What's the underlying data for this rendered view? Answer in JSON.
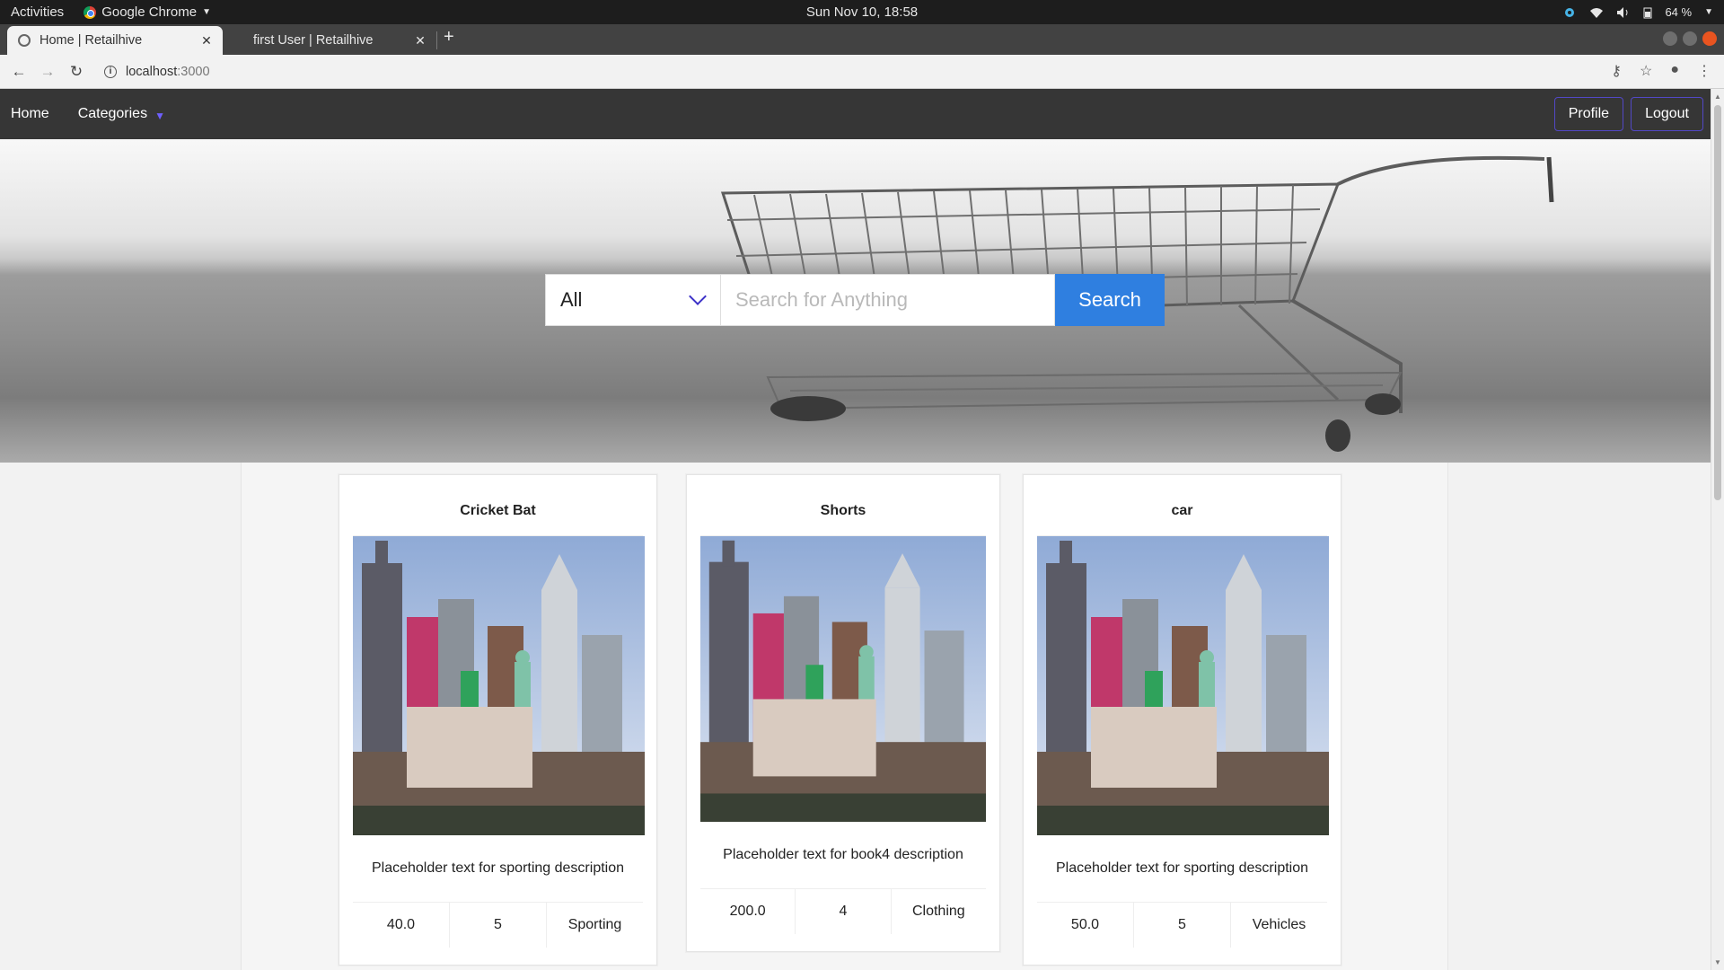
{
  "os": {
    "activities": "Activities",
    "app_name": "Google Chrome",
    "clock": "Sun Nov 10, 18:58",
    "battery": "64 %"
  },
  "browser": {
    "tabs": [
      {
        "title": "Home | Retailhive",
        "active": true
      },
      {
        "title": "first User | Retailhive",
        "active": false
      }
    ],
    "url_host": "localhost",
    "url_port": ":3000"
  },
  "navbar": {
    "home": "Home",
    "categories": "Categories",
    "profile": "Profile",
    "logout": "Logout"
  },
  "search": {
    "category_selected": "All",
    "placeholder": "Search for Anything",
    "button": "Search"
  },
  "products": [
    {
      "title": "Cricket Bat",
      "description": "Placeholder text for sporting description",
      "price": "40.0",
      "quantity": "5",
      "category": "Sporting"
    },
    {
      "title": "Shorts",
      "description": "Placeholder text for book4 description",
      "price": "200.0",
      "quantity": "4",
      "category": "Clothing"
    },
    {
      "title": "car",
      "description": "Placeholder text for sporting description",
      "price": "50.0",
      "quantity": "5",
      "category": "Vehicles"
    }
  ],
  "colors": {
    "navbar_bg": "#363636",
    "accent": "#5248c6",
    "search_button": "#2f7fe0"
  }
}
